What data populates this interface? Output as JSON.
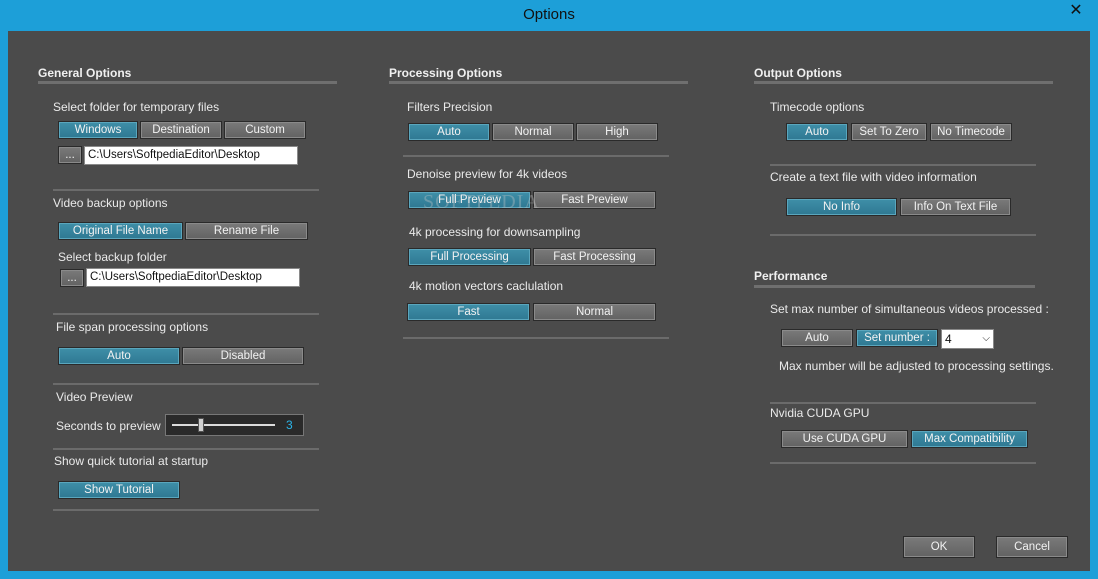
{
  "window": {
    "title": "Options",
    "close_glyph": "✕"
  },
  "general": {
    "header": "General Options",
    "temp_label": "Select folder for temporary files",
    "temp_buttons": [
      "Windows",
      "Destination",
      "Custom"
    ],
    "browse": "...",
    "temp_path": "C:\\Users\\SoftpediaEditor\\Desktop",
    "backup_label": "Video backup options",
    "backup_buttons": [
      "Original File Name",
      "Rename File"
    ],
    "backup_folder_label": "Select backup folder",
    "backup_path": "C:\\Users\\SoftpediaEditor\\Desktop",
    "filespan_label": "File span processing options",
    "filespan_buttons": [
      "Auto",
      "Disabled"
    ],
    "preview_label": "Video Preview",
    "seconds_label": "Seconds to preview",
    "seconds_value": "3",
    "seconds_fraction": 0.3,
    "tutorial_label": "Show quick tutorial at startup",
    "tutorial_button": "Show Tutorial"
  },
  "processing": {
    "header": "Processing Options",
    "filters_label": "Filters Precision",
    "filters_buttons": [
      "Auto",
      "Normal",
      "High"
    ],
    "denoise_label": "Denoise preview for 4k videos",
    "denoise_buttons": [
      "Full Preview",
      "Fast Preview"
    ],
    "downsample_label": "4k processing for downsampling",
    "downsample_buttons": [
      "Full Processing",
      "Fast Processing"
    ],
    "motion_label": "4k motion vectors caclulation",
    "motion_buttons": [
      "Fast",
      "Normal"
    ]
  },
  "output": {
    "header": "Output Options",
    "timecode_label": "Timecode options",
    "timecode_buttons": [
      "Auto",
      "Set To Zero",
      "No Timecode"
    ],
    "textfile_label": "Create a text file with video information",
    "textfile_buttons": [
      "No Info",
      "Info On Text File"
    ]
  },
  "performance": {
    "header": "Performance",
    "max_label": "Set max number of simultaneous videos processed :",
    "max_buttons": [
      "Auto",
      "Set number :"
    ],
    "max_value": "4",
    "max_note": "Max number will be adjusted to processing settings.",
    "cuda_label": "Nvidia CUDA GPU",
    "cuda_buttons": [
      "Use CUDA GPU",
      "Max Compatibility"
    ]
  },
  "footer": {
    "ok": "OK",
    "cancel": "Cancel"
  },
  "watermark": "SOFTPEDIA"
}
